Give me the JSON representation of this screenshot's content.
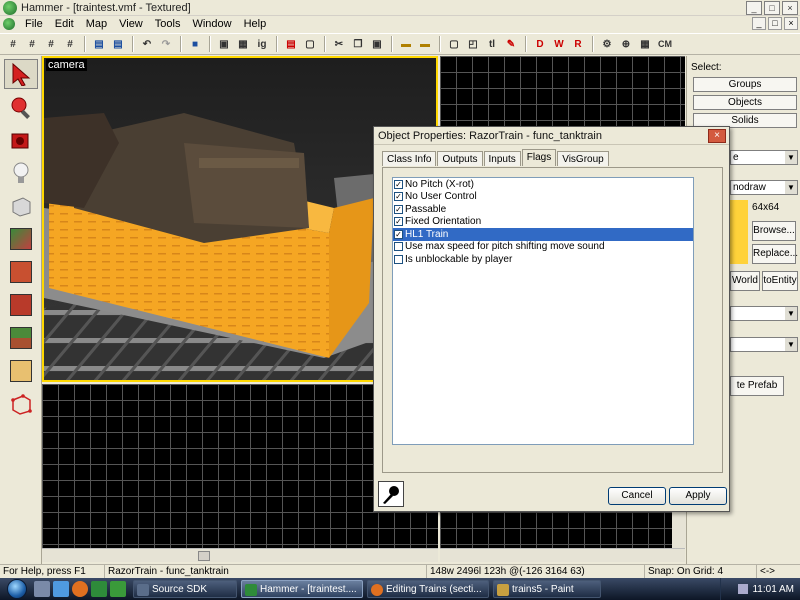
{
  "window": {
    "title": "Hammer - [traintest.vmf - Textured]",
    "minimize": "_",
    "maximize": "□",
    "close": "×"
  },
  "menu": [
    "File",
    "Edit",
    "Map",
    "View",
    "Tools",
    "Window",
    "Help"
  ],
  "mdi_buttons": [
    "_",
    "□",
    "×"
  ],
  "toolbar": {
    "cm_label": "CM"
  },
  "viewports": {
    "camera_label": "camera"
  },
  "right_panel": {
    "select_label": "Select:",
    "groups": "Groups",
    "objects": "Objects",
    "solids": "Solids",
    "combo1_value": "e",
    "combo2_value": "nodraw",
    "texture_size": "64x64",
    "browse": "Browse...",
    "replace": "Replace...",
    "to_world": "World",
    "to_entity": "toEntity",
    "create_prefab": "te Prefab"
  },
  "dialog": {
    "title": "Object Properties: RazorTrain - func_tanktrain",
    "close": "×",
    "tabs": [
      "Class Info",
      "Outputs",
      "Inputs",
      "Flags",
      "VisGroup"
    ],
    "active_tab": "Flags",
    "flags": [
      {
        "label": "No Pitch (X-rot)",
        "checked": true
      },
      {
        "label": "No User Control",
        "checked": true
      },
      {
        "label": "Passable",
        "checked": true
      },
      {
        "label": "Fixed Orientation",
        "checked": true
      },
      {
        "label": "HL1 Train",
        "checked": true,
        "selected": true
      },
      {
        "label": "Use max speed for pitch shifting move sound",
        "checked": false
      },
      {
        "label": "Is unblockable by player",
        "checked": false
      }
    ],
    "cancel": "Cancel",
    "apply": "Apply"
  },
  "status": {
    "help": "For Help, press F1",
    "selection": "RazorTrain - func_tanktrain",
    "coords": "148w 2496l 123h @(-126 3164 63)",
    "snap": "Snap: On Grid: 4",
    "extra": "<->"
  },
  "taskbar": {
    "tasks": [
      {
        "label": "Source SDK",
        "color": "#5a6d8a",
        "active": false
      },
      {
        "label": "Hammer - [traintest....",
        "color": "#2e8b3a",
        "active": true
      },
      {
        "label": "Editing Trains (secti...",
        "color": "#e07020",
        "active": false
      },
      {
        "label": "trains5 - Paint",
        "color": "#c8a040",
        "active": false
      }
    ],
    "clock": "11:01 AM"
  },
  "colors": {
    "selection_yellow": "#ffd800",
    "orange_brush": "#f5a623",
    "dialog_select": "#316ac5"
  }
}
